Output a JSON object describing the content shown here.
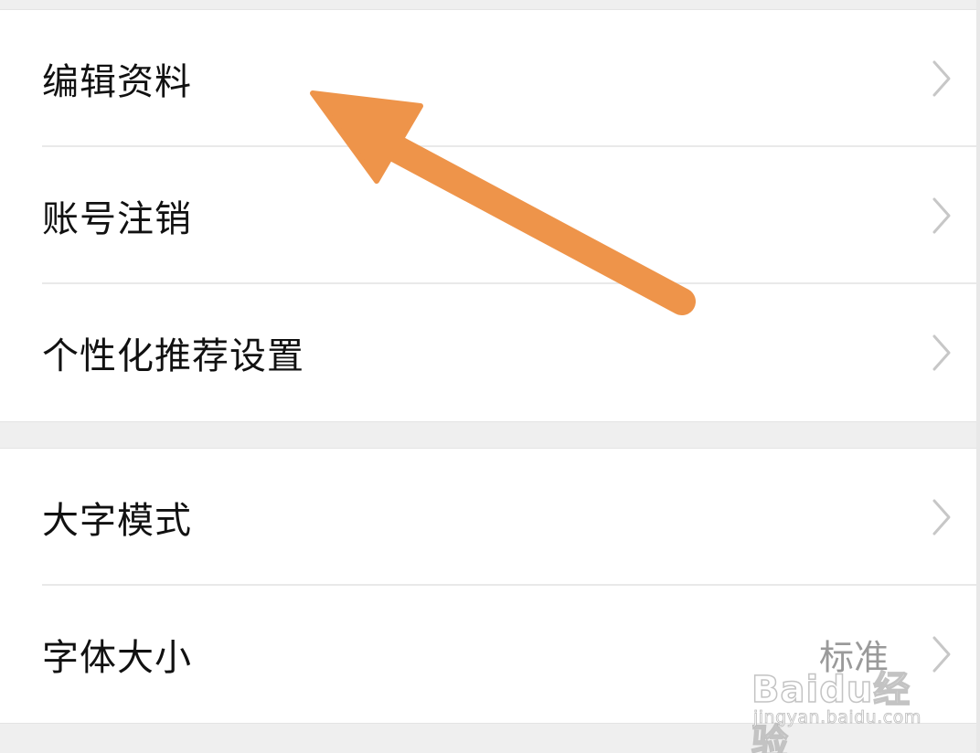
{
  "settings": {
    "group1": [
      {
        "label": "编辑资料"
      },
      {
        "label": "账号注销"
      },
      {
        "label": "个性化推荐设置"
      }
    ],
    "group2": [
      {
        "label": "大字模式"
      },
      {
        "label": "字体大小",
        "value": "标准"
      }
    ]
  },
  "icons": {
    "chevron": "chevron-right-icon",
    "annotation": "orange-arrow-icon"
  },
  "colors": {
    "background": "#efefef",
    "card": "#ffffff",
    "label": "#111111",
    "value": "#9a9a9a",
    "chevron": "#c7c7c7",
    "arrow": "#ee944a"
  },
  "watermark": {
    "logo": "Baidu经验",
    "url": "jingyan.baidu.com"
  }
}
